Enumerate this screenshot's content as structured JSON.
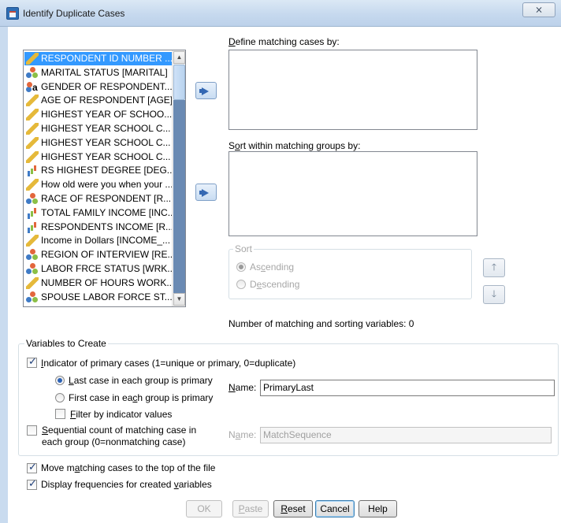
{
  "window": {
    "title": "Identify Duplicate Cases",
    "close_glyph": "⨯"
  },
  "variables": [
    {
      "label": "RESPONDENT ID NUMBER ...",
      "icon": "scale-ruler-icon",
      "selected": true
    },
    {
      "label": "MARITAL STATUS [MARITAL]",
      "icon": "nominal-icon"
    },
    {
      "label": "GENDER OF RESPONDENT...",
      "icon": "nominal-string-icon"
    },
    {
      "label": "AGE OF RESPONDENT [AGE]",
      "icon": "scale-ruler-icon"
    },
    {
      "label": "HIGHEST YEAR OF SCHOO...",
      "icon": "scale-ruler-icon"
    },
    {
      "label": "HIGHEST YEAR SCHOOL C...",
      "icon": "scale-ruler-icon"
    },
    {
      "label": "HIGHEST YEAR SCHOOL C...",
      "icon": "scale-ruler-icon"
    },
    {
      "label": "HIGHEST YEAR SCHOOL C...",
      "icon": "scale-ruler-icon"
    },
    {
      "label": "RS HIGHEST DEGREE [DEG...",
      "icon": "ordinal-icon"
    },
    {
      "label": "How old were you when your ...",
      "icon": "scale-ruler-icon"
    },
    {
      "label": "RACE OF RESPONDENT [R...",
      "icon": "nominal-icon"
    },
    {
      "label": "TOTAL FAMILY INCOME [INC...",
      "icon": "ordinal-icon"
    },
    {
      "label": "RESPONDENTS INCOME [R...",
      "icon": "ordinal-icon"
    },
    {
      "label": "Income in Dollars [INCOME_...",
      "icon": "scale-ruler-icon"
    },
    {
      "label": "REGION OF INTERVIEW [RE...",
      "icon": "nominal-icon"
    },
    {
      "label": "LABOR FRCE STATUS [WRK...",
      "icon": "nominal-icon"
    },
    {
      "label": "NUMBER OF HOURS WORK...",
      "icon": "scale-ruler-icon"
    },
    {
      "label": "SPOUSE LABOR FORCE ST...",
      "icon": "nominal-icon"
    }
  ],
  "matching": {
    "label_pre": "",
    "label_u": "D",
    "label_post": "efine matching cases by:"
  },
  "sorting": {
    "label_pre": "S",
    "label_u": "o",
    "label_post": "rt within matching groups by:"
  },
  "sort_group": {
    "title": "Sort",
    "ascending_pre": "As",
    "ascending_u": "c",
    "ascending_post": "ending",
    "descending_pre": "D",
    "descending_u": "e",
    "descending_post": "scending",
    "up_glyph": "🡑",
    "down_glyph": "🡓"
  },
  "count_text": "Number of matching and sorting variables: 0",
  "create_group": {
    "title": "Variables to Create",
    "primary_pre": "",
    "primary_u": "I",
    "primary_post": "ndicator of primary cases (1=unique or primary, 0=duplicate)",
    "last_pre": "",
    "last_u": "L",
    "last_post": "ast case in each group is primary",
    "first_pre": "First case in ea",
    "first_u": "c",
    "first_post": "h group is primary",
    "filter_pre": "",
    "filter_u": "F",
    "filter_post": "ilter by indicator values",
    "name1_pre": "",
    "name1_u": "N",
    "name1_post": "ame:",
    "name1_value": "PrimaryLast",
    "sequential_line1_pre": "",
    "sequential_line1_u": "S",
    "sequential_line1_post": "equential count of matching case in",
    "sequential_line2": "each group (0=nonmatching case)",
    "name2_pre": "N",
    "name2_u": "a",
    "name2_post": "me:",
    "name2_value": "MatchSequence"
  },
  "options": {
    "move_pre": "Move m",
    "move_u": "a",
    "move_post": "tching cases to the top of the file",
    "display_pre": "Display frequencies for created ",
    "display_u": "v",
    "display_post": "ariables"
  },
  "buttons": {
    "ok": "OK",
    "paste_pre": "",
    "paste_u": "P",
    "paste_post": "aste",
    "reset_pre": "",
    "reset_u": "R",
    "reset_post": "eset",
    "cancel": "Cancel",
    "help": "Help"
  },
  "colors": {
    "selection": "#3399ff",
    "title_gradient": "#c6d9ee",
    "move_arrow": "#3468b3"
  }
}
